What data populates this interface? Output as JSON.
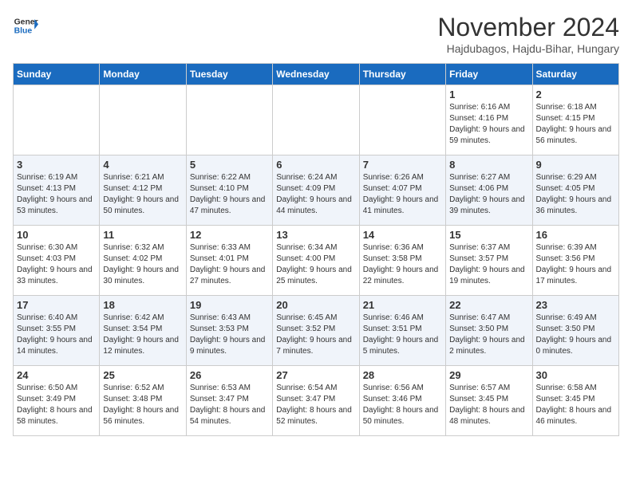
{
  "header": {
    "logo_line1": "General",
    "logo_line2": "Blue",
    "month_title": "November 2024",
    "location": "Hajdubagos, Hajdu-Bihar, Hungary"
  },
  "weekdays": [
    "Sunday",
    "Monday",
    "Tuesday",
    "Wednesday",
    "Thursday",
    "Friday",
    "Saturday"
  ],
  "weeks": [
    [
      {
        "day": "",
        "details": ""
      },
      {
        "day": "",
        "details": ""
      },
      {
        "day": "",
        "details": ""
      },
      {
        "day": "",
        "details": ""
      },
      {
        "day": "",
        "details": ""
      },
      {
        "day": "1",
        "details": "Sunrise: 6:16 AM\nSunset: 4:16 PM\nDaylight: 9 hours and 59 minutes."
      },
      {
        "day": "2",
        "details": "Sunrise: 6:18 AM\nSunset: 4:15 PM\nDaylight: 9 hours and 56 minutes."
      }
    ],
    [
      {
        "day": "3",
        "details": "Sunrise: 6:19 AM\nSunset: 4:13 PM\nDaylight: 9 hours and 53 minutes."
      },
      {
        "day": "4",
        "details": "Sunrise: 6:21 AM\nSunset: 4:12 PM\nDaylight: 9 hours and 50 minutes."
      },
      {
        "day": "5",
        "details": "Sunrise: 6:22 AM\nSunset: 4:10 PM\nDaylight: 9 hours and 47 minutes."
      },
      {
        "day": "6",
        "details": "Sunrise: 6:24 AM\nSunset: 4:09 PM\nDaylight: 9 hours and 44 minutes."
      },
      {
        "day": "7",
        "details": "Sunrise: 6:26 AM\nSunset: 4:07 PM\nDaylight: 9 hours and 41 minutes."
      },
      {
        "day": "8",
        "details": "Sunrise: 6:27 AM\nSunset: 4:06 PM\nDaylight: 9 hours and 39 minutes."
      },
      {
        "day": "9",
        "details": "Sunrise: 6:29 AM\nSunset: 4:05 PM\nDaylight: 9 hours and 36 minutes."
      }
    ],
    [
      {
        "day": "10",
        "details": "Sunrise: 6:30 AM\nSunset: 4:03 PM\nDaylight: 9 hours and 33 minutes."
      },
      {
        "day": "11",
        "details": "Sunrise: 6:32 AM\nSunset: 4:02 PM\nDaylight: 9 hours and 30 minutes."
      },
      {
        "day": "12",
        "details": "Sunrise: 6:33 AM\nSunset: 4:01 PM\nDaylight: 9 hours and 27 minutes."
      },
      {
        "day": "13",
        "details": "Sunrise: 6:34 AM\nSunset: 4:00 PM\nDaylight: 9 hours and 25 minutes."
      },
      {
        "day": "14",
        "details": "Sunrise: 6:36 AM\nSunset: 3:58 PM\nDaylight: 9 hours and 22 minutes."
      },
      {
        "day": "15",
        "details": "Sunrise: 6:37 AM\nSunset: 3:57 PM\nDaylight: 9 hours and 19 minutes."
      },
      {
        "day": "16",
        "details": "Sunrise: 6:39 AM\nSunset: 3:56 PM\nDaylight: 9 hours and 17 minutes."
      }
    ],
    [
      {
        "day": "17",
        "details": "Sunrise: 6:40 AM\nSunset: 3:55 PM\nDaylight: 9 hours and 14 minutes."
      },
      {
        "day": "18",
        "details": "Sunrise: 6:42 AM\nSunset: 3:54 PM\nDaylight: 9 hours and 12 minutes."
      },
      {
        "day": "19",
        "details": "Sunrise: 6:43 AM\nSunset: 3:53 PM\nDaylight: 9 hours and 9 minutes."
      },
      {
        "day": "20",
        "details": "Sunrise: 6:45 AM\nSunset: 3:52 PM\nDaylight: 9 hours and 7 minutes."
      },
      {
        "day": "21",
        "details": "Sunrise: 6:46 AM\nSunset: 3:51 PM\nDaylight: 9 hours and 5 minutes."
      },
      {
        "day": "22",
        "details": "Sunrise: 6:47 AM\nSunset: 3:50 PM\nDaylight: 9 hours and 2 minutes."
      },
      {
        "day": "23",
        "details": "Sunrise: 6:49 AM\nSunset: 3:50 PM\nDaylight: 9 hours and 0 minutes."
      }
    ],
    [
      {
        "day": "24",
        "details": "Sunrise: 6:50 AM\nSunset: 3:49 PM\nDaylight: 8 hours and 58 minutes."
      },
      {
        "day": "25",
        "details": "Sunrise: 6:52 AM\nSunset: 3:48 PM\nDaylight: 8 hours and 56 minutes."
      },
      {
        "day": "26",
        "details": "Sunrise: 6:53 AM\nSunset: 3:47 PM\nDaylight: 8 hours and 54 minutes."
      },
      {
        "day": "27",
        "details": "Sunrise: 6:54 AM\nSunset: 3:47 PM\nDaylight: 8 hours and 52 minutes."
      },
      {
        "day": "28",
        "details": "Sunrise: 6:56 AM\nSunset: 3:46 PM\nDaylight: 8 hours and 50 minutes."
      },
      {
        "day": "29",
        "details": "Sunrise: 6:57 AM\nSunset: 3:45 PM\nDaylight: 8 hours and 48 minutes."
      },
      {
        "day": "30",
        "details": "Sunrise: 6:58 AM\nSunset: 3:45 PM\nDaylight: 8 hours and 46 minutes."
      }
    ]
  ]
}
